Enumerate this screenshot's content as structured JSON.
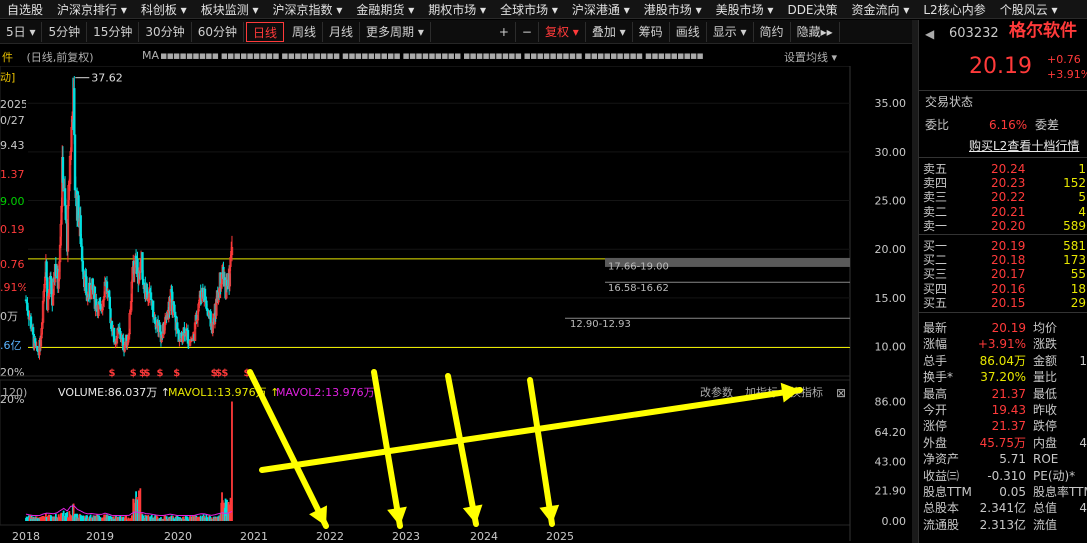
{
  "menubar": [
    "自选股",
    "沪深京排行 ▾",
    "科创板 ▾",
    "板块监测 ▾",
    "沪深京指数 ▾",
    "金融期货 ▾",
    "期权市场 ▾",
    "全球市场 ▾",
    "沪深港通 ▾",
    "港股市场 ▾",
    "美股市场 ▾",
    "DDE决策",
    "资金流向 ▾",
    "L2核心内参",
    "个股风云 ▾"
  ],
  "toolbar": {
    "periods": [
      "5日 ▾",
      "5分钟",
      "15分钟",
      "30分钟",
      "60分钟",
      "日线",
      "周线",
      "月线",
      "更多周期 ▾"
    ],
    "active_period": "日线",
    "controls": [
      "+",
      "−",
      "复权 ▾",
      "叠加 ▾",
      "筹码",
      "画线",
      "显示 ▾",
      "简约",
      "隐藏▸▸"
    ]
  },
  "chart_header": {
    "stock_char": "件",
    "mode": "(日线,前复权)",
    "ma_label": "MA",
    "ma_values": "▪▪▪▪▪▪▪▪▪ ▪▪▪▪▪▪▪▪▪ ▪▪▪▪▪▪▪▪▪ ▪▪▪▪▪▪▪▪▪ ▪▪▪▪▪▪▪▪▪ ▪▪▪▪▪▪▪▪▪ ▪▪▪▪▪▪▪▪▪ ▪▪▪▪▪▪▪▪▪ ▪▪▪▪▪▪▪▪▪",
    "ma_setting": "设置均线 ▾"
  },
  "left_axis": [
    {
      "t": "动]",
      "c": "#e8c000"
    },
    {
      "t": "2025",
      "c": "#c8c8c8"
    },
    {
      "t": "0/27",
      "c": "#c8c8c8"
    },
    {
      "t": "9.43",
      "c": "#c8c8c8"
    },
    {
      "t": "1.37",
      "c": "#ff3a3a"
    },
    {
      "t": "9.00",
      "c": "#00d000"
    },
    {
      "t": "0.19",
      "c": "#ff3a3a"
    },
    {
      "t": "0.76",
      "c": "#ff3a3a"
    },
    {
      "t": ".91%",
      "c": "#ff3a3a"
    },
    {
      "t": "0万",
      "c": "#c8c8c8"
    },
    {
      "t": ".6亿",
      "c": "#5ab4ff"
    },
    {
      "t": "20%",
      "c": "#c8c8c8"
    },
    {
      "t": "20%",
      "c": "#c8c8c8"
    }
  ],
  "price_axis": [
    "35.00",
    "30.00",
    "25.00",
    "20.00",
    "15.00",
    "10.00"
  ],
  "volume_axis": [
    "86.00",
    "64.20",
    "43.00",
    "21.90",
    "0.00"
  ],
  "x_years": [
    "2018",
    "2019",
    "2020",
    "2021",
    "2022",
    "2023",
    "2024",
    "2025"
  ],
  "annotations": {
    "high_label": "37.62",
    "band1": "17.66-19.00",
    "band2": "16.58-16.62",
    "band3": "12.90-12.93"
  },
  "volume_header": {
    "prefix": "120)",
    "volume": "VOLUME:86.037万 ↑",
    "mavol1": "MAVOL1:13.976万 ↑",
    "mavol2": "MAVOL2:13.976万",
    "params": "改参数",
    "add": "加指标",
    "change": "换指标",
    "close": "⊠"
  },
  "colors": {
    "up": "#ff3a3a",
    "down": "#00e0e0",
    "ma_yellow": "#e8e800",
    "accent_red": "#ff3a3a",
    "green": "#00d000",
    "blue": "#5ab4ff",
    "annotation_yellow": "#ffff00"
  },
  "chart_data": {
    "type": "candlestick",
    "x_ticks": [
      "2018",
      "2019",
      "2020",
      "2021",
      "2022",
      "2023",
      "2024",
      "2025"
    ],
    "price_ylim": [
      8,
      38
    ],
    "price_ticks": [
      10,
      15,
      20,
      25,
      30,
      35
    ],
    "volume_ticks": [
      0,
      21.9,
      43.0,
      64.2,
      86.0
    ],
    "volume_ylim": [
      0,
      90
    ],
    "max_price": 37.62,
    "last_close": 20.19,
    "last_volume": 86.037,
    "horizontal_lines": [
      19.0,
      9.9
    ],
    "close_trend": [
      [
        0,
        14.8
      ],
      [
        0.06,
        12.6
      ],
      [
        0.1,
        10.5
      ],
      [
        0.14,
        9.4
      ],
      [
        0.18,
        10.0
      ],
      [
        0.21,
        12.8
      ],
      [
        0.24,
        17.0
      ],
      [
        0.26,
        19.0
      ],
      [
        0.28,
        14.5
      ],
      [
        0.32,
        16.5
      ],
      [
        0.35,
        14.0
      ],
      [
        0.38,
        18.5
      ],
      [
        0.42,
        16.5
      ],
      [
        0.46,
        24.0
      ],
      [
        0.48,
        29.0
      ],
      [
        0.51,
        24.0
      ],
      [
        0.54,
        21.0
      ],
      [
        0.58,
        30.0
      ],
      [
        0.61,
        34.0
      ],
      [
        0.62,
        36.5
      ],
      [
        0.64,
        27.0
      ],
      [
        0.67,
        24.5
      ],
      [
        0.7,
        23.0
      ],
      [
        0.73,
        20.0
      ],
      [
        0.76,
        17.5
      ],
      [
        0.8,
        15.0
      ],
      [
        0.86,
        16.0
      ],
      [
        0.92,
        14.5
      ],
      [
        0.98,
        13.5
      ],
      [
        1.04,
        17.0
      ],
      [
        1.1,
        13.5
      ],
      [
        1.16,
        10.5
      ],
      [
        1.22,
        11.5
      ],
      [
        1.28,
        10.0
      ],
      [
        1.34,
        11.0
      ],
      [
        1.4,
        17.5
      ],
      [
        1.44,
        19.5
      ],
      [
        1.48,
        17.0
      ],
      [
        1.52,
        18.5
      ],
      [
        1.56,
        15.5
      ],
      [
        1.6,
        16.0
      ],
      [
        1.66,
        14.0
      ],
      [
        1.72,
        12.5
      ],
      [
        1.78,
        11.0
      ],
      [
        1.84,
        13.0
      ],
      [
        1.9,
        15.0
      ],
      [
        1.96,
        12.5
      ],
      [
        2.02,
        10.5
      ],
      [
        2.08,
        12.0
      ],
      [
        2.14,
        10.5
      ],
      [
        2.2,
        11.0
      ],
      [
        2.26,
        14.5
      ],
      [
        2.32,
        16.0
      ],
      [
        2.38,
        13.5
      ],
      [
        2.44,
        12.0
      ],
      [
        2.5,
        14.5
      ],
      [
        2.56,
        17.5
      ],
      [
        2.62,
        16.0
      ],
      [
        2.66,
        17.0
      ],
      [
        2.7,
        20.19
      ]
    ],
    "signals_years": [
      1.12,
      1.4,
      1.52,
      1.58,
      1.75,
      1.97,
      2.46,
      2.52,
      2.6,
      2.89
    ]
  },
  "right_panel": {
    "code": "603232",
    "name": "格尔软件",
    "price": "20.19",
    "change": "+0.76",
    "change_pct": "+3.91%",
    "section_title": "交易状态",
    "webi_label": "委比",
    "webi_value": "6.16%",
    "weicha_label": "委差",
    "l2_link": "购买L2查看十档行情",
    "asks": [
      {
        "label": "卖五",
        "price": "20.24",
        "vol": "1"
      },
      {
        "label": "卖四",
        "price": "20.23",
        "vol": "152"
      },
      {
        "label": "卖三",
        "price": "20.22",
        "vol": "5"
      },
      {
        "label": "卖二",
        "price": "20.21",
        "vol": "4"
      },
      {
        "label": "卖一",
        "price": "20.20",
        "vol": "589"
      }
    ],
    "bids": [
      {
        "label": "买一",
        "price": "20.19",
        "vol": "581"
      },
      {
        "label": "买二",
        "price": "20.18",
        "vol": "173"
      },
      {
        "label": "买三",
        "price": "20.17",
        "vol": "55"
      },
      {
        "label": "买四",
        "price": "20.16",
        "vol": "18"
      },
      {
        "label": "买五",
        "price": "20.15",
        "vol": "29"
      }
    ],
    "stats": [
      {
        "l1": "最新",
        "v1": "20.19",
        "c1": "#ff3a3a",
        "l2": "均价",
        "v2": ""
      },
      {
        "l1": "涨幅",
        "v1": "+3.91%",
        "c1": "#ff3a3a",
        "l2": "涨跌",
        "v2": ""
      },
      {
        "l1": "总手",
        "v1": "86.04万",
        "c1": "#e8e800",
        "l2": "金额",
        "v2": "1"
      },
      {
        "l1": "换手*",
        "v1": "37.20%",
        "c1": "#e8e800",
        "l2": "量比",
        "v2": ""
      },
      {
        "l1": "最高",
        "v1": "21.37",
        "c1": "#ff3a3a",
        "l2": "最低",
        "v2": ""
      },
      {
        "l1": "今开",
        "v1": "19.43",
        "c1": "#ff3a3a",
        "l2": "昨收",
        "v2": ""
      },
      {
        "l1": "涨停",
        "v1": "21.37",
        "c1": "#ff3a3a",
        "l2": "跌停",
        "v2": ""
      },
      {
        "l1": "外盘",
        "v1": "45.75万",
        "c1": "#ff3a3a",
        "l2": "内盘",
        "v2": "4"
      },
      {
        "l1": "净资产",
        "v1": "5.71",
        "c1": "#c8c8c8",
        "l2": "ROE",
        "v2": ""
      },
      {
        "l1": "收益㈢",
        "v1": "-0.310",
        "c1": "#c8c8c8",
        "l2": "PE(动)*",
        "v2": ""
      },
      {
        "l1": "股息TTM",
        "v1": "0.05",
        "c1": "#c8c8c8",
        "l2": "股息率TTM",
        "v2": ""
      },
      {
        "l1": "总股本",
        "v1": "2.341亿",
        "c1": "#c8c8c8",
        "l2": "总值",
        "v2": "4"
      },
      {
        "l1": "流通股",
        "v1": "2.313亿",
        "c1": "#c8c8c8",
        "l2": "流值",
        "v2": ""
      }
    ]
  }
}
